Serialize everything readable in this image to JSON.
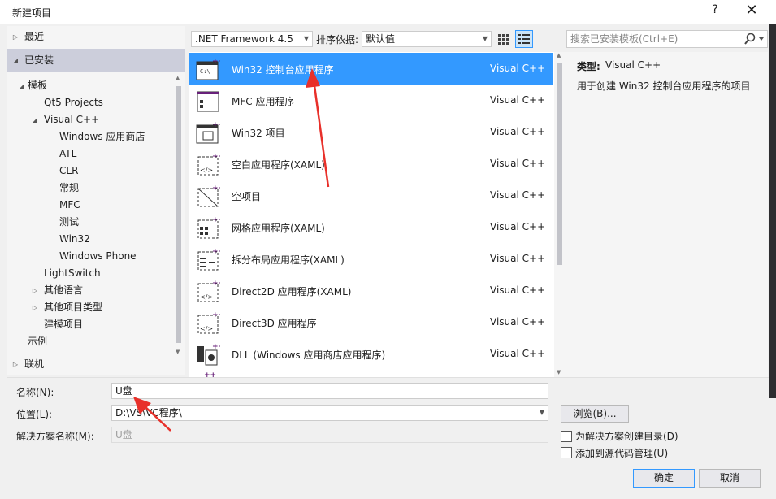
{
  "window": {
    "title": "新建项目",
    "help": "?",
    "close": "✕"
  },
  "tree": {
    "recent": "最近",
    "installed": "已安装",
    "templates": "模板",
    "qt5": "Qt5 Projects",
    "vcpp": "Visual C++",
    "vc_children": [
      "Windows 应用商店",
      "ATL",
      "CLR",
      "常规",
      "MFC",
      "测试",
      "Win32",
      "Windows Phone"
    ],
    "lightswitch": "LightSwitch",
    "other_langs": "其他语言",
    "other_types": "其他项目类型",
    "modeling": "建模项目",
    "samples": "示例",
    "online": "联机"
  },
  "toolbar": {
    "framework": ".NET Framework 4.5",
    "sort_label": "排序依据:",
    "sort_value": "默认值",
    "search_placeholder": "搜索已安装模板(Ctrl+E)"
  },
  "templates": [
    {
      "name": "Win32 控制台应用程序",
      "lang": "Visual C++",
      "selected": true
    },
    {
      "name": "MFC 应用程序",
      "lang": "Visual C++"
    },
    {
      "name": "Win32 项目",
      "lang": "Visual C++"
    },
    {
      "name": "空白应用程序(XAML)",
      "lang": "Visual C++"
    },
    {
      "name": "空项目",
      "lang": "Visual C++"
    },
    {
      "name": "网格应用程序(XAML)",
      "lang": "Visual C++"
    },
    {
      "name": "拆分布局应用程序(XAML)",
      "lang": "Visual C++"
    },
    {
      "name": "Direct2D 应用程序(XAML)",
      "lang": "Visual C++"
    },
    {
      "name": "Direct3D 应用程序",
      "lang": "Visual C++"
    },
    {
      "name": "DLL (Windows 应用商店应用程序)",
      "lang": "Visual C++"
    }
  ],
  "description": {
    "type_label": "类型:",
    "type_value": "Visual C++",
    "text": "用于创建 Win32 控制台应用程序的项目"
  },
  "form": {
    "name_label": "名称(N):",
    "name_value": "U盘",
    "location_label": "位置(L):",
    "location_value": "D:\\VS\\VC程序\\",
    "solution_label": "解决方案名称(M):",
    "solution_value": "U盘",
    "browse": "浏览(B)...",
    "create_dir": "为解决方案创建目录(D)",
    "add_scm": "添加到源代码管理(U)",
    "ok": "确定",
    "cancel": "取消"
  },
  "colors": {
    "selection": "#3399ff",
    "annotation_arrow": "#e8302a"
  }
}
